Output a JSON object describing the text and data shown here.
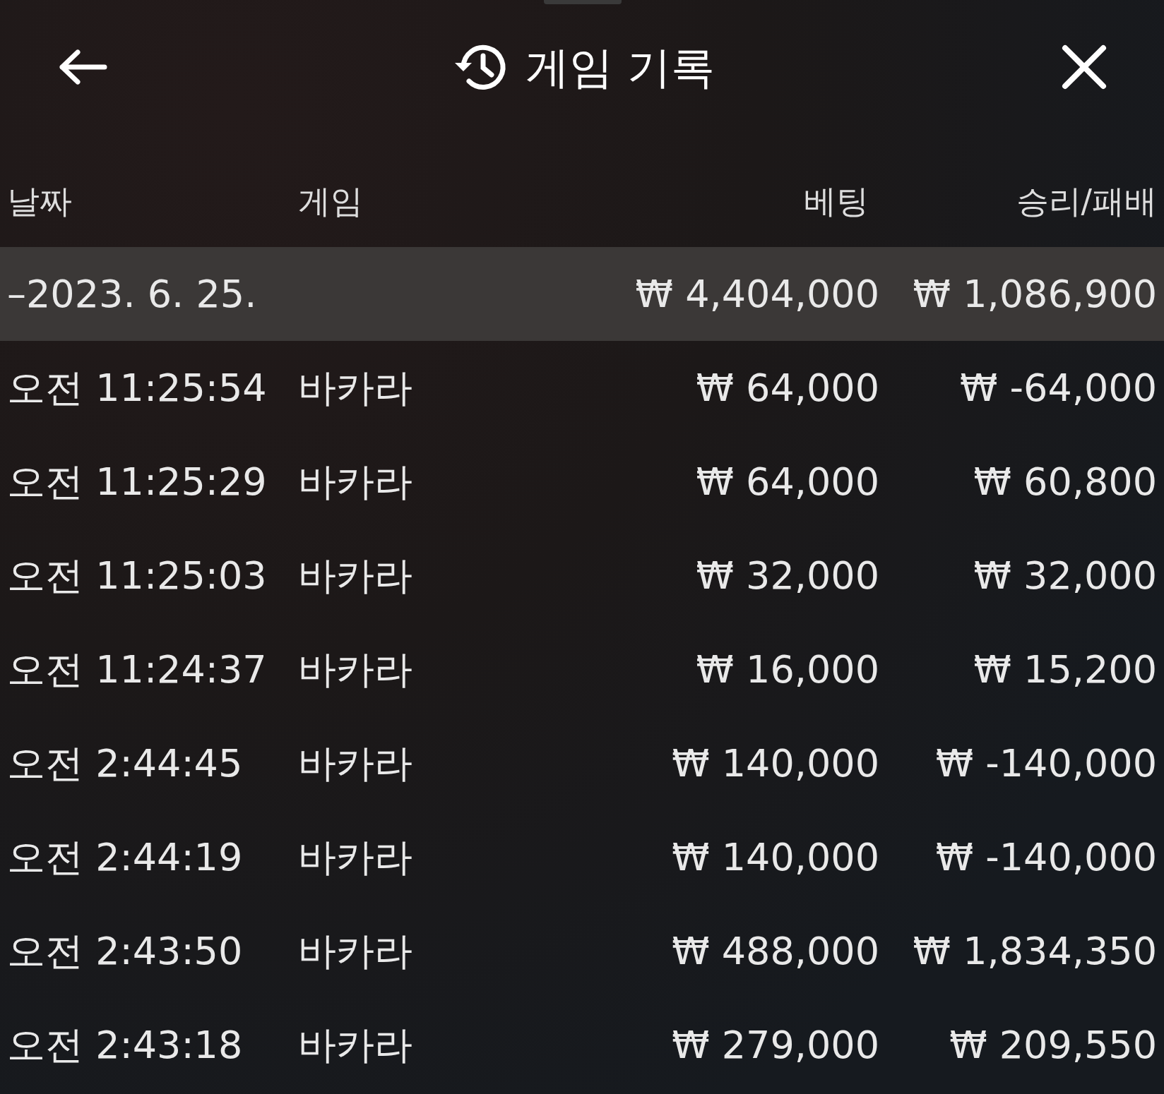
{
  "header": {
    "title": "게임 기록"
  },
  "columns": [
    "날짜",
    "게임",
    "베팅",
    "승리/패배"
  ],
  "date_group": {
    "date": "–2023. 6. 25.",
    "bet": "₩ 4,404,000",
    "result": "₩ 1,086,900"
  },
  "rows": [
    {
      "time": "오전 11:25:54",
      "game": "바카라",
      "bet": "₩ 64,000",
      "result": "₩ -64,000"
    },
    {
      "time": "오전 11:25:29",
      "game": "바카라",
      "bet": "₩ 64,000",
      "result": "₩ 60,800"
    },
    {
      "time": "오전 11:25:03",
      "game": "바카라",
      "bet": "₩ 32,000",
      "result": "₩ 32,000"
    },
    {
      "time": "오전 11:24:37",
      "game": "바카라",
      "bet": "₩ 16,000",
      "result": "₩ 15,200"
    },
    {
      "time": "오전 2:44:45",
      "game": "바카라",
      "bet": "₩ 140,000",
      "result": "₩ -140,000"
    },
    {
      "time": "오전 2:44:19",
      "game": "바카라",
      "bet": "₩ 140,000",
      "result": "₩ -140,000"
    },
    {
      "time": "오전 2:43:50",
      "game": "바카라",
      "bet": "₩ 488,000",
      "result": "₩ 1,834,350"
    },
    {
      "time": "오전 2:43:18",
      "game": "바카라",
      "bet": "₩ 279,000",
      "result": "₩ 209,550"
    }
  ]
}
